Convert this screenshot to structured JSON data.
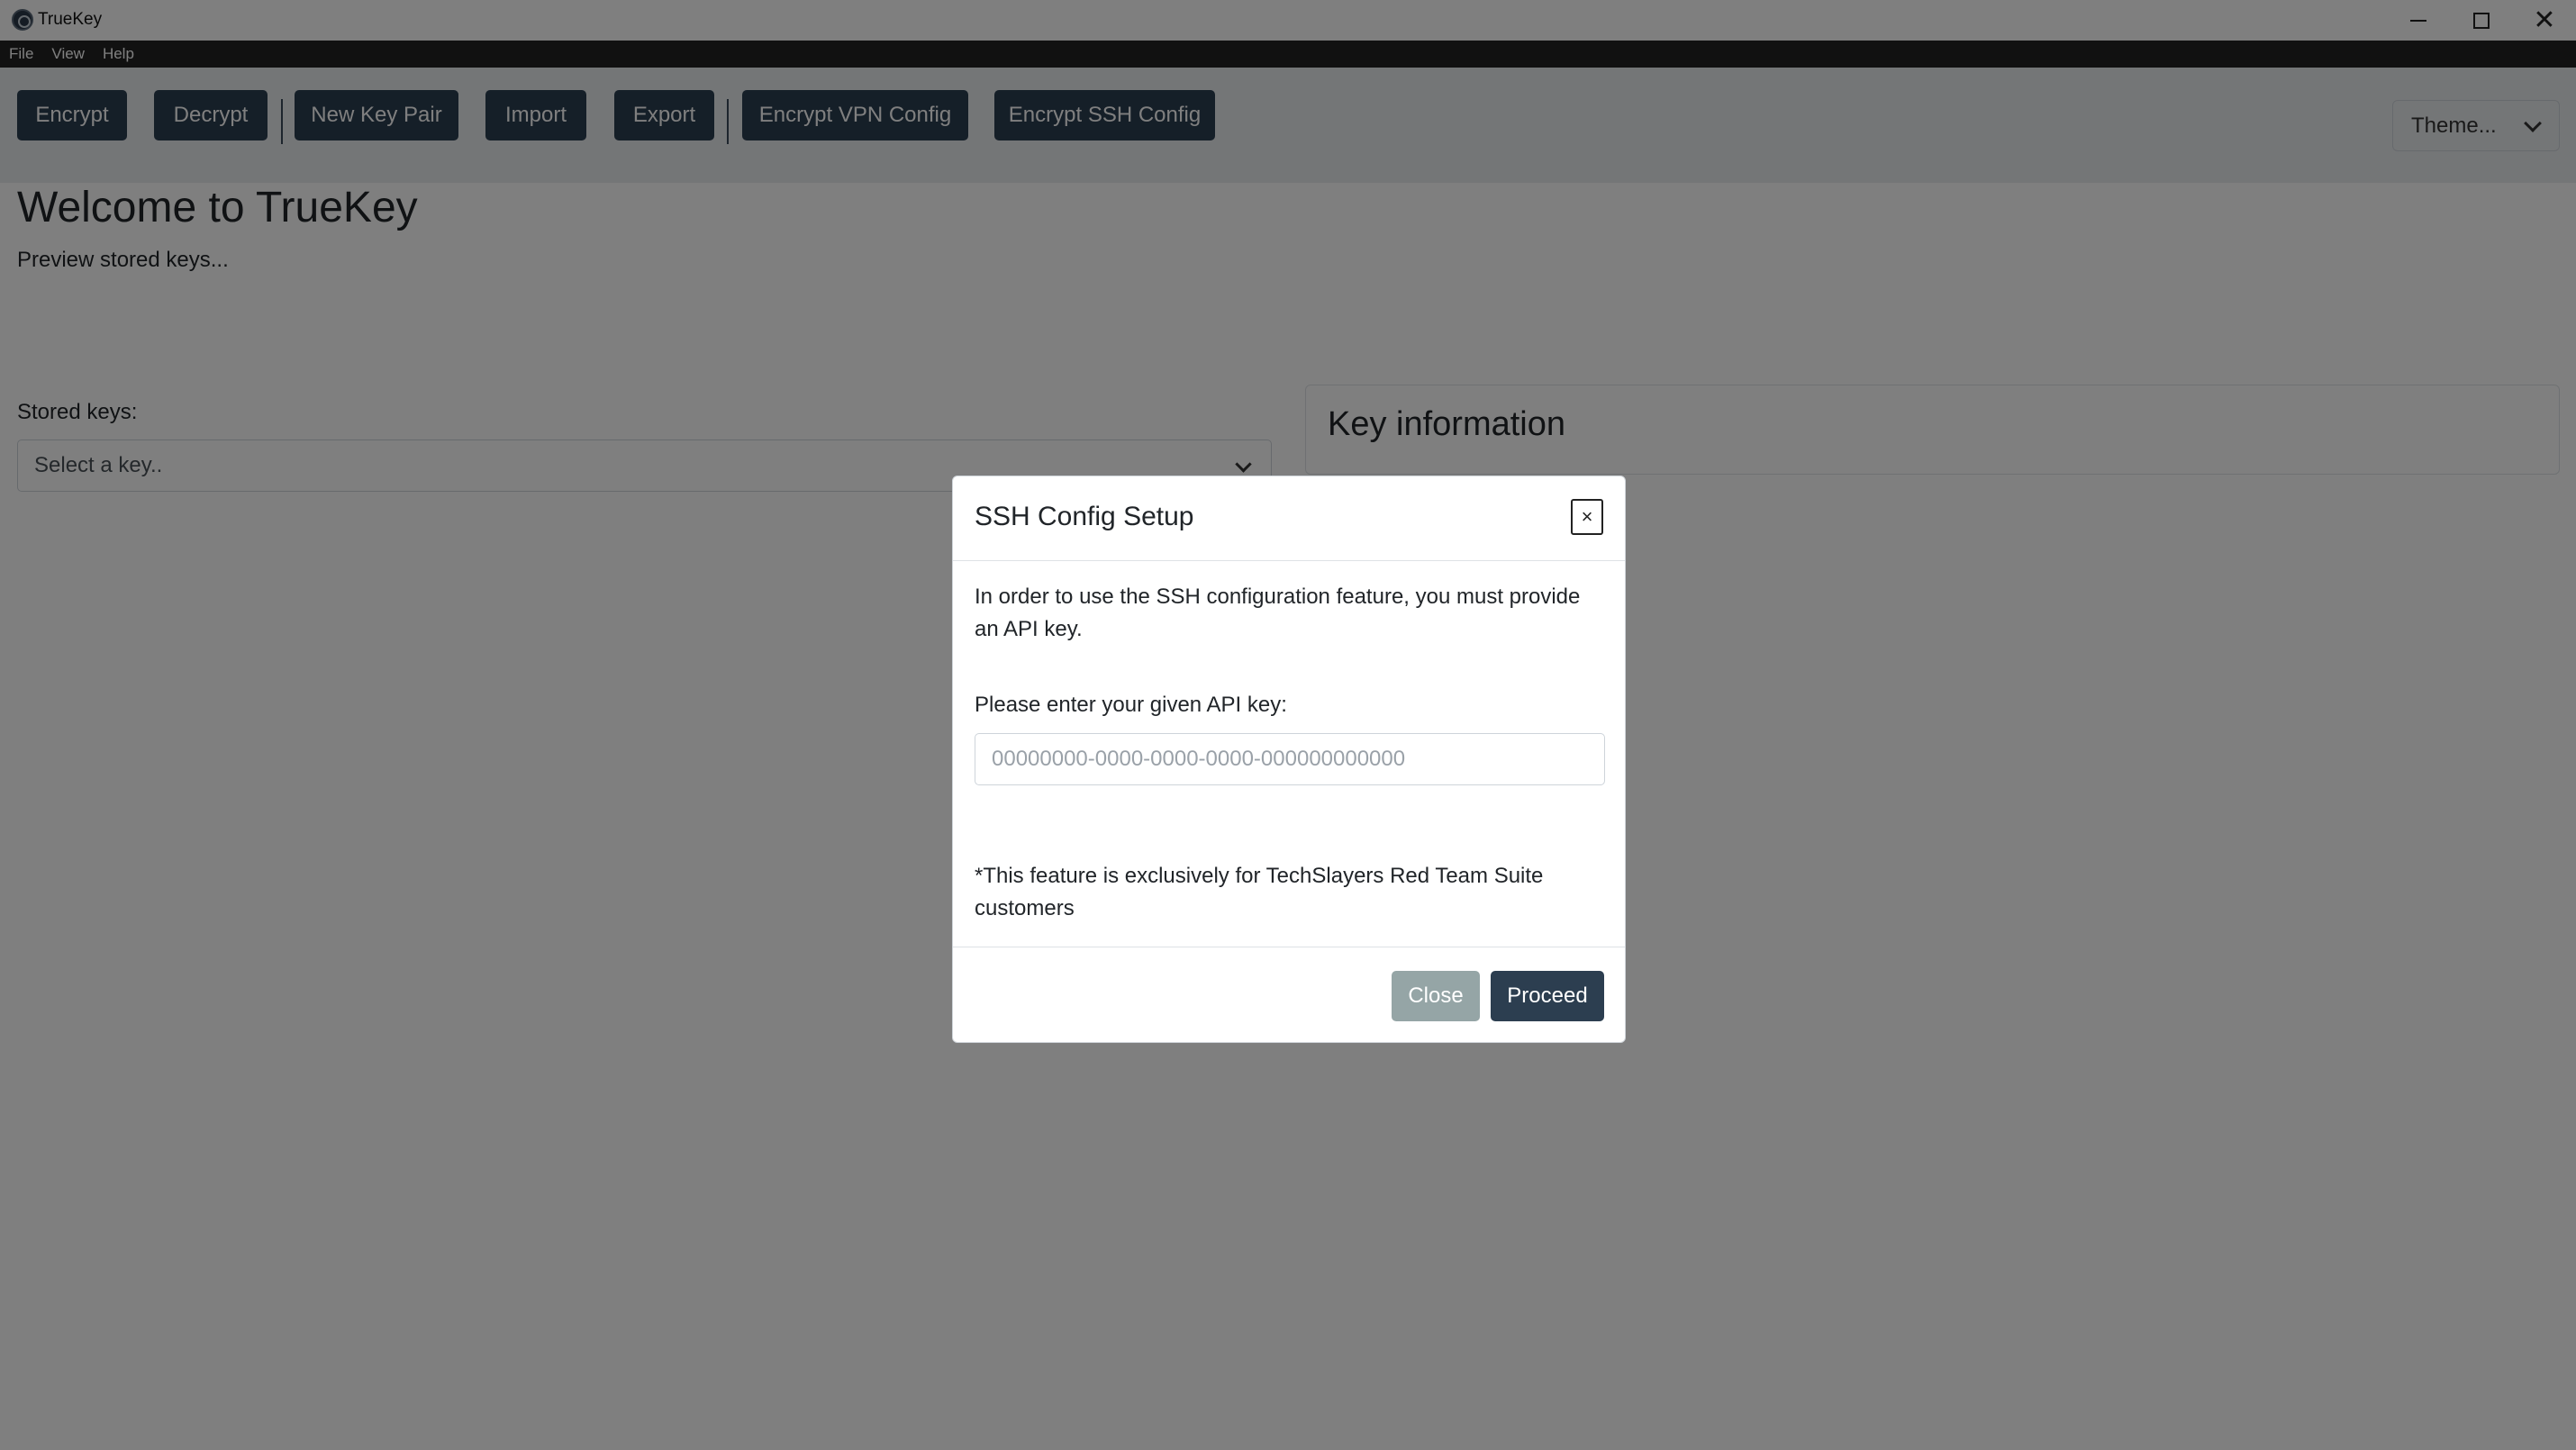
{
  "window": {
    "title": "TrueKey",
    "controls": [
      "minimize-icon",
      "maximize-icon",
      "close-icon"
    ]
  },
  "menubar": {
    "items": [
      "File",
      "View",
      "Help"
    ]
  },
  "toolbar": {
    "buttons": [
      "Encrypt",
      "Decrypt",
      "New Key Pair",
      "Import",
      "Export",
      "Encrypt VPN Config",
      "Encrypt SSH Config"
    ],
    "theme_select": "Theme..."
  },
  "main": {
    "welcome_title": "Welcome to TrueKey",
    "subtitle": "Preview stored keys...",
    "stored_keys_label": "Stored keys:",
    "key_select_value": "Select a key..",
    "info_card_title": "Key information"
  },
  "modal": {
    "title": "SSH Config Setup",
    "close_symbol": "×",
    "text": "In order to use the SSH configuration feature, you must provide an API key.",
    "input_label": "Please enter your given API key:",
    "input_placeholder": "00000000-0000-0000-0000-000000000000",
    "note": "*This feature is exclusively for TechSlayers Red Team Suite customers",
    "close_label": "Close",
    "proceed_label": "Proceed"
  },
  "colors": {
    "toolbar_button": "#2b3e50",
    "close_button": "#95a5a6",
    "proceed_button": "#2c3e50",
    "menubar": "#222222"
  }
}
